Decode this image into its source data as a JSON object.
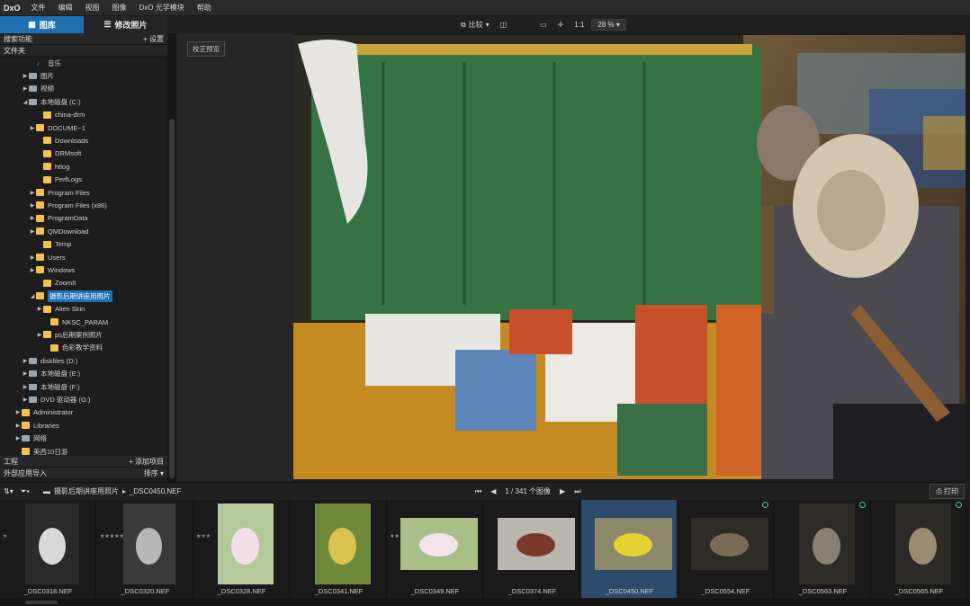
{
  "menubar": {
    "logo": "DxO",
    "items": [
      "文件",
      "编辑",
      "视图",
      "图像",
      "DxO 光学模块",
      "帮助"
    ]
  },
  "tabs": {
    "library": "图库",
    "edit": "修改照片"
  },
  "toolbar": {
    "compare": "比较",
    "ratio": "1:1",
    "zoom": "28 %"
  },
  "left": {
    "search_title": "搜索功能",
    "settings": "+ 设置",
    "folders_title": "文件夹",
    "tree": [
      {
        "label": "音乐",
        "icon": "note",
        "arrow": ""
      },
      {
        "label": "图片",
        "icon": "drive",
        "arrow": "▶"
      },
      {
        "label": "视频",
        "icon": "drive",
        "arrow": "▶"
      },
      {
        "label": "本地磁盘 (C:)",
        "icon": "drive",
        "arrow": "◢"
      },
      {
        "label": "china-drm",
        "icon": "folder",
        "arrow": ""
      },
      {
        "label": "DOCUME~1",
        "icon": "folder",
        "arrow": "▶"
      },
      {
        "label": "Downloads",
        "icon": "folder",
        "arrow": ""
      },
      {
        "label": "DRMsoft",
        "icon": "folder",
        "arrow": ""
      },
      {
        "label": "htlog",
        "icon": "folder",
        "arrow": ""
      },
      {
        "label": "PerfLogs",
        "icon": "folder",
        "arrow": ""
      },
      {
        "label": "Program Files",
        "icon": "folder",
        "arrow": "▶"
      },
      {
        "label": "Program Files (x86)",
        "icon": "folder",
        "arrow": "▶"
      },
      {
        "label": "ProgramData",
        "icon": "folder",
        "arrow": "▶"
      },
      {
        "label": "QMDownload",
        "icon": "folder",
        "arrow": "▶"
      },
      {
        "label": "Temp",
        "icon": "folder",
        "arrow": ""
      },
      {
        "label": "Users",
        "icon": "folder",
        "arrow": "▶"
      },
      {
        "label": "Windows",
        "icon": "folder",
        "arrow": "▶"
      },
      {
        "label": "ZoomIt",
        "icon": "folder",
        "arrow": ""
      },
      {
        "label": "摄影后期讲座用照片",
        "icon": "folder",
        "arrow": "◢",
        "selected": true
      },
      {
        "label": "Alien Skin",
        "icon": "folder",
        "arrow": "▶"
      },
      {
        "label": "NKSC_PARAM",
        "icon": "folder",
        "arrow": ""
      },
      {
        "label": "ps后期案例照片",
        "icon": "folder",
        "arrow": "▶"
      },
      {
        "label": "色彩教学资料",
        "icon": "folder",
        "arrow": ""
      },
      {
        "label": "diskfiles (D:)",
        "icon": "drive",
        "arrow": "▶"
      },
      {
        "label": "本地磁盘 (E:)",
        "icon": "drive",
        "arrow": "▶"
      },
      {
        "label": "本地磁盘 (F:)",
        "icon": "drive",
        "arrow": "▶"
      },
      {
        "label": "DVD 驱动器 (G:)",
        "icon": "drive",
        "arrow": "▶"
      },
      {
        "label": "Administrator",
        "icon": "folder",
        "arrow": "▶"
      },
      {
        "label": "Libraries",
        "icon": "folder",
        "arrow": "▶"
      },
      {
        "label": "网络",
        "icon": "drive",
        "arrow": "▶"
      },
      {
        "label": "美西10日游",
        "icon": "folder",
        "arrow": ""
      }
    ],
    "project_title": "工程",
    "add_project": "+ 添加项目",
    "external_title": "外部应用导入",
    "sort": "排序 ▾"
  },
  "mid": {
    "calibrate": "校正预览"
  },
  "nav": {
    "path_folder": "摄影后期讲座用照片",
    "path_file": "_DSC0450.NEF",
    "counter": "1 / 341 个图像",
    "print": "打印"
  },
  "film": [
    {
      "name": "_DSC0318.NEF",
      "stars": "★",
      "kind": "bw"
    },
    {
      "name": "_DSC0320.NEF",
      "stars": "★★★★★",
      "kind": "bw2"
    },
    {
      "name": "_DSC0328.NEF",
      "stars": "★★★",
      "kind": "lotus1"
    },
    {
      "name": "_DSC0341.NEF",
      "stars": "",
      "kind": "lotus2"
    },
    {
      "name": "_DSC0349.NEF",
      "stars": "★★",
      "kind": "lotus3"
    },
    {
      "name": "_DSC0374.NEF",
      "stars": "",
      "kind": "street"
    },
    {
      "name": "_DSC0450.NEF",
      "stars": "",
      "kind": "field",
      "selected": true
    },
    {
      "name": "_DSC0554.NEF",
      "stars": "",
      "kind": "dark1",
      "pin": true
    },
    {
      "name": "_DSC0563.NEF",
      "stars": "",
      "kind": "dark2",
      "pin": true
    },
    {
      "name": "_DSC0565.NEF",
      "stars": "",
      "kind": "dark3",
      "pin": true
    }
  ]
}
